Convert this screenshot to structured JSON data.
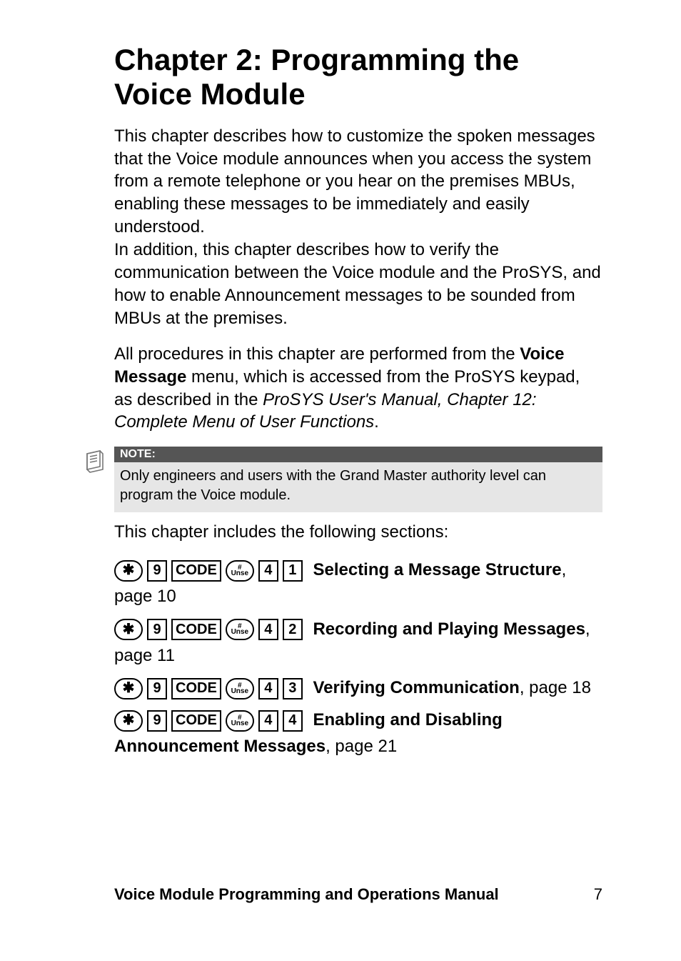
{
  "chapter_title": "Chapter 2: Programming the Voice Module",
  "para1_a": "This chapter describes how to customize the spoken messages that the Voice module announces when you access the system from a remote telephone or you hear on the premises MBUs, enabling these messages to be immediately and easily understood.",
  "para1_b": "In addition, this chapter describes how to verify the communication between the Voice module and the ProSYS, and how to enable Announcement messages to be sounded from MBUs at the premises.",
  "para2_lead": "All procedures in this chapter are performed from the ",
  "para2_bold": "Voice Message",
  "para2_mid": " menu, which is accessed from the ProSYS keypad, as described in the ",
  "para2_ital": "ProSYS User's Manual, Chapter 12: Complete Menu of User Functions",
  "para2_end": ".",
  "note": {
    "label": "NOTE:",
    "text": "Only engineers and users with the Grand Master authority level can program the Voice module."
  },
  "sections_intro": "This chapter includes the following sections:",
  "key_labels": {
    "star": "✱",
    "nine": "9",
    "code": "CODE",
    "hash_top": "#",
    "hash_bottom": "Unse",
    "four": "4",
    "d1": "1",
    "d2": "2",
    "d3": "3",
    "d4": "4"
  },
  "entries": [
    {
      "digit": "1",
      "title": "Selecting a Message Structure",
      "page": ", page 10"
    },
    {
      "digit": "2",
      "title": "Recording and Playing Messages",
      "page": ", page 11"
    },
    {
      "digit": "3",
      "title": "Verifying Communication",
      "page": ", page 18"
    },
    {
      "digit": "4",
      "title": "Enabling and Disabling Announcement Messages",
      "page": ", page 21"
    }
  ],
  "footer": {
    "title": "Voice Module Programming and Operations Manual",
    "page": "7"
  }
}
